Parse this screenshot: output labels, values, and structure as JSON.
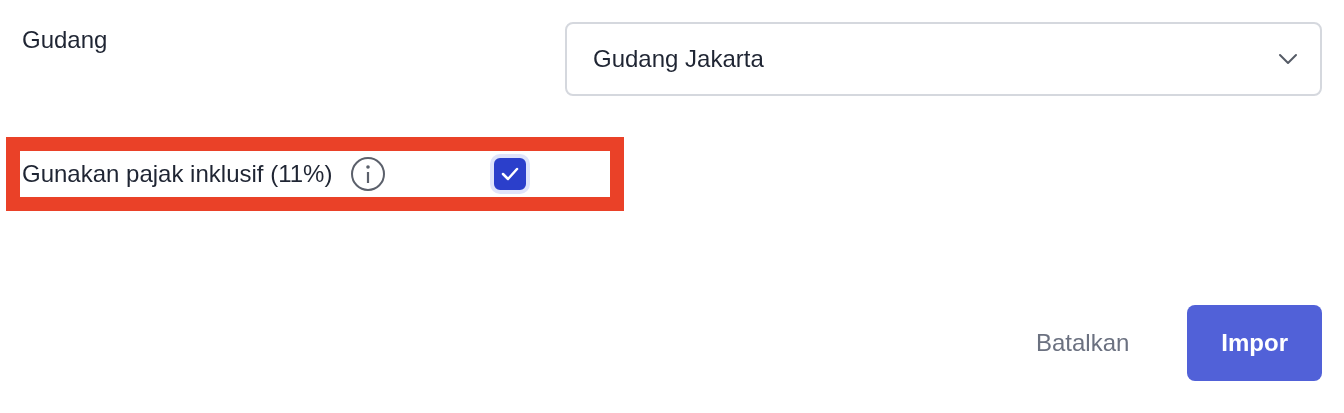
{
  "warehouse": {
    "label": "Gudang",
    "value": "Gudang Jakarta"
  },
  "tax_option": {
    "label": "Gunakan pajak inklusif (11%)",
    "checked": true,
    "highlighted": true
  },
  "buttons": [
    {
      "label": "Batalkan",
      "kind": "secondary"
    },
    {
      "label": "Impor",
      "kind": "primary"
    }
  ]
}
